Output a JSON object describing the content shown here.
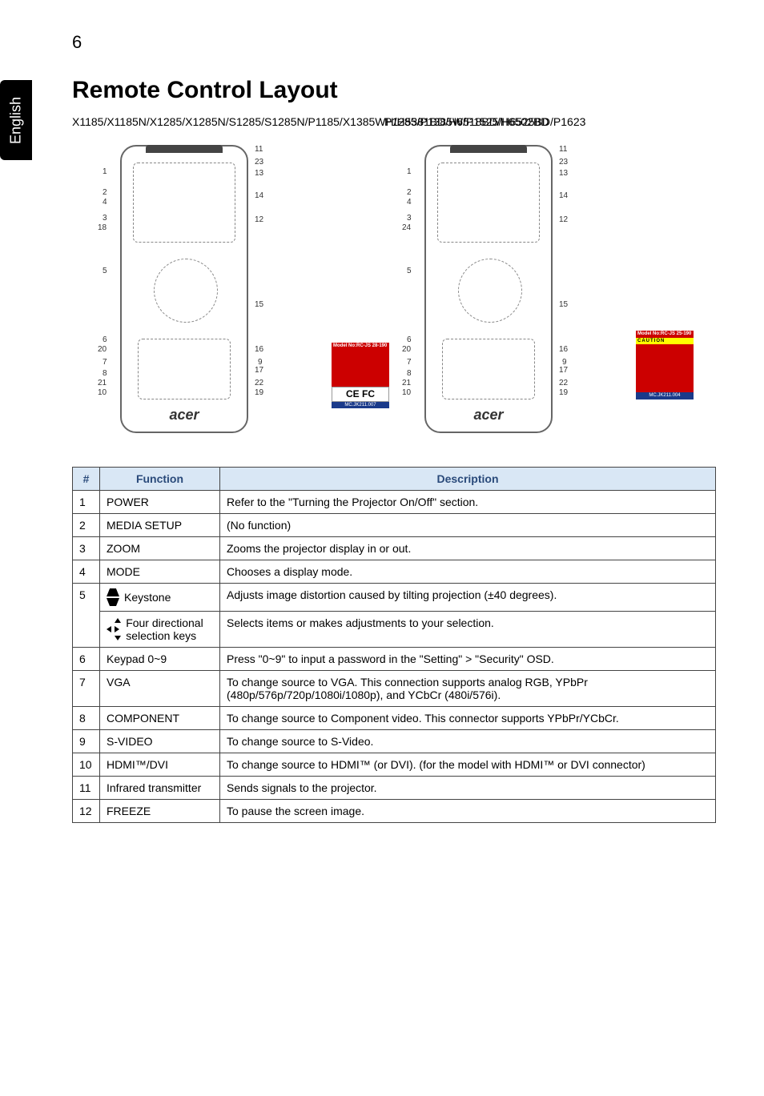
{
  "page_number": "6",
  "side_tab": "English",
  "heading": "Remote Control Layout",
  "models": {
    "left": "X1185/X1185N/X1285/X1285N/S1285/S1285N/P1185/X1385WH/H5381BD/H6518BD/H6502BD",
    "right": "P1285/P1385W/P1525/H6525BD/P1623"
  },
  "acer": "acer",
  "diagram_left_numbers": [
    "1",
    "2",
    "4",
    "3",
    "18",
    "5",
    "6",
    "20",
    "7",
    "8",
    "21",
    "10",
    "11",
    "23",
    "13",
    "14",
    "12",
    "15",
    "16",
    "9",
    "17",
    "22",
    "19"
  ],
  "diagram_right_numbers": [
    "1",
    "2",
    "4",
    "3",
    "24",
    "5",
    "6",
    "20",
    "7",
    "8",
    "21",
    "10",
    "11",
    "23",
    "13",
    "14",
    "12",
    "15",
    "16",
    "9",
    "17",
    "22",
    "19"
  ],
  "label_left": {
    "model": "Model No:RC-JS 28-190",
    "ce": "CE  FC",
    "mc": "MC.JK211.007"
  },
  "label_right": {
    "model": "Model No:RC-JS 25-190",
    "caution": "CAUTION",
    "mc": "MC.JK211.004"
  },
  "table": {
    "headers": {
      "num": "#",
      "func": "Function",
      "desc": "Description"
    },
    "rows": [
      {
        "n": "1",
        "f": "POWER",
        "d": "Refer to the \"Turning the Projector On/Off\" section."
      },
      {
        "n": "2",
        "f": "MEDIA SETUP",
        "d": "(No function)"
      },
      {
        "n": "3",
        "f": "ZOOM",
        "d": "Zooms the projector display in or out."
      },
      {
        "n": "4",
        "f": "MODE",
        "d": "Chooses a display mode."
      },
      {
        "n": "5",
        "f_key": "Keystone",
        "d": "Adjusts image distortion caused by tilting projection (±40 degrees)."
      },
      {
        "n": "",
        "f_dir": "Four directional selection keys",
        "d": "Selects items or makes adjustments to your selection."
      },
      {
        "n": "6",
        "f": "Keypad 0~9",
        "d": "Press \"0~9\" to input a password in the \"Setting\" > \"Security\" OSD."
      },
      {
        "n": "7",
        "f": "VGA",
        "d": "To change source to VGA. This connection supports analog RGB, YPbPr (480p/576p/720p/1080i/1080p), and YCbCr (480i/576i)."
      },
      {
        "n": "8",
        "f": "COMPONENT",
        "d": "To change source to Component video. This connector supports YPbPr/YCbCr."
      },
      {
        "n": "9",
        "f": "S-VIDEO",
        "d": "To change source to S-Video."
      },
      {
        "n": "10",
        "f": "HDMI™/DVI",
        "d": "To change source to HDMI™ (or DVI). (for the model with HDMI™ or DVI connector)"
      },
      {
        "n": "11",
        "f": "Infrared transmitter",
        "d": "Sends signals to the projector."
      },
      {
        "n": "12",
        "f": "FREEZE",
        "d": "To pause the screen image."
      }
    ]
  }
}
